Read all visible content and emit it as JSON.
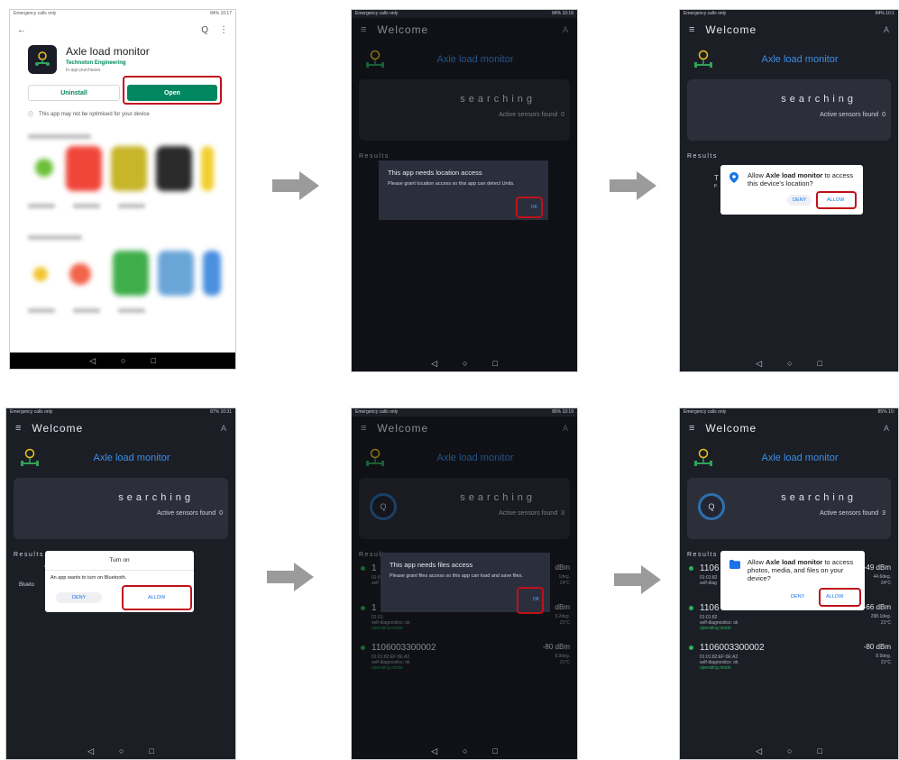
{
  "colors": {
    "accent": "#3a8fe8",
    "highlight": "#c0111a",
    "online": "#25b35a",
    "play_green": "#01875f"
  },
  "status_bar": {
    "carrier": "Emergency calls only",
    "p1_status": "84% 10:17",
    "p2_status": "84% 10:18",
    "p3_status": "84% 10:1",
    "p4_status": "87% 10:31",
    "p5_status": "85% 10:19",
    "p6_status": "85% 10:"
  },
  "play_store": {
    "app_name": "Axle load monitor",
    "developer": "Technoton Engineering",
    "in_app": "In app purchases",
    "uninstall_label": "Uninstall",
    "open_label": "Open",
    "warning": "This app may not be optimised for your device"
  },
  "app": {
    "title": "Welcome",
    "brand": "Axle load monitor",
    "searching": "searching",
    "found_label": "Active sensors found",
    "results_label": "Results"
  },
  "counts": {
    "p2": "0",
    "p3": "0",
    "p4": "0",
    "p5": "3",
    "p6": "3"
  },
  "dialogs": {
    "location_title": "This app needs location access",
    "location_msg": "Please grant location access so this app can detect Units.",
    "ok_label": "OK",
    "loc_perm_pre": "Allow ",
    "loc_perm_app": "Axle load monitor",
    "loc_perm_post": " to access this device's location?",
    "deny_label": "DENY",
    "allow_label": "ALLOW",
    "bt_title": "Turn on",
    "bt_msg": "An app wants to turn on Bluetooth.",
    "bt_bg_word": "Blueto",
    "files_title": "This app needs files access",
    "files_msg": "Please grant files access so this app can load and save files.",
    "files_perm_pre": "Allow ",
    "files_perm_app": "Axle load monitor",
    "files_perm_post": " to access photos, media, and files on your device?"
  },
  "peek_p3": {
    "t": "T",
    "p": "p"
  },
  "peek_p4": {
    "a": "A"
  },
  "p5_rows": [
    {
      "id": "1",
      "dbm": "dBm",
      "deg": "1deg.",
      "tmp": "24°C",
      "mac": "01:01:",
      "diag": "self",
      "mode": ""
    },
    {
      "id": "1",
      "dbm": "dBm",
      "deg": "3.2deg.",
      "tmp": "21°C",
      "mac": "01:01:",
      "diag": "self-diagnostics: ok",
      "mode": "operating mode"
    },
    {
      "id": "1106003300002",
      "dbm": "-80 dBm",
      "deg": "8.9deg.",
      "tmp": "21°C",
      "mac": "01:01:82:EF:0E:A2",
      "diag": "self-diagnostics: ok",
      "mode": "operating mode"
    }
  ],
  "p6_rows": [
    {
      "id": "1106",
      "dbm": "-49 dBm",
      "deg": "44.6deg.",
      "tmp": "24°C",
      "mac": "01:01:82",
      "diag": "self-diag",
      "mode": ""
    },
    {
      "id": "1106",
      "dbm": "-66 dBm",
      "deg": "298.1deg.",
      "tmp": "21°C",
      "mac": "01:01:82",
      "diag": "self-diagnostics: ok",
      "mode": "operating mode"
    },
    {
      "id": "1106003300002",
      "dbm": "-80 dBm",
      "deg": "8.9deg.",
      "tmp": "21°C",
      "mac": "01:01:82:EF:0E:A2",
      "diag": "self-diagnostics: ok",
      "mode": "operating mode"
    }
  ],
  "icons": {
    "back": "←",
    "search": "Q",
    "more": "⋮",
    "menu": "≡",
    "person": "A",
    "nav_back": "◁",
    "nav_home": "○",
    "nav_recent": "□",
    "info": "ⓘ"
  }
}
